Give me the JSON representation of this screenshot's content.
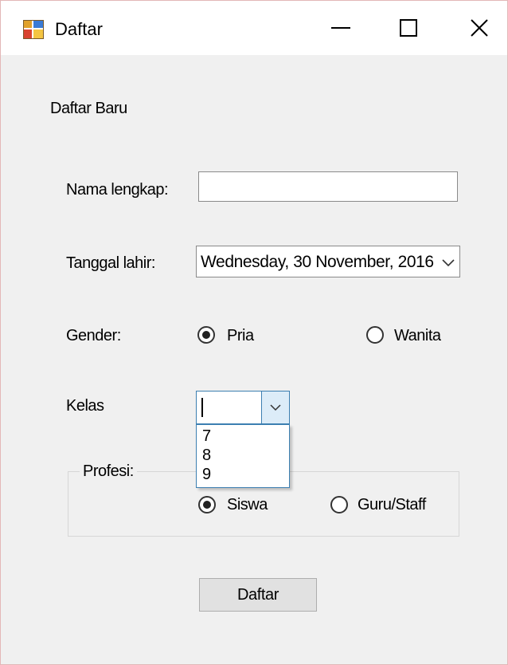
{
  "window": {
    "title": "Daftar",
    "icon": "app-form-icon",
    "controls": [
      "minimize-icon",
      "maximize-icon",
      "close-icon"
    ]
  },
  "form": {
    "heading": "Daftar Baru",
    "name_label": "Nama lengkap:",
    "name_value": "",
    "date_label": "Tanggal lahir:",
    "date_value": "Wednesday, 30 November, 2016",
    "gender_label": "Gender:",
    "gender_options": [
      "Pria",
      "Wanita"
    ],
    "gender_selected": "Pria",
    "class_label": "Kelas",
    "class_value": "",
    "class_options": [
      "7",
      "8",
      "9"
    ],
    "profession_legend": "Profesi:",
    "profession_options": [
      "Siswa",
      "Guru/Staff"
    ],
    "profession_selected": "Siswa",
    "submit_label": "Daftar"
  }
}
